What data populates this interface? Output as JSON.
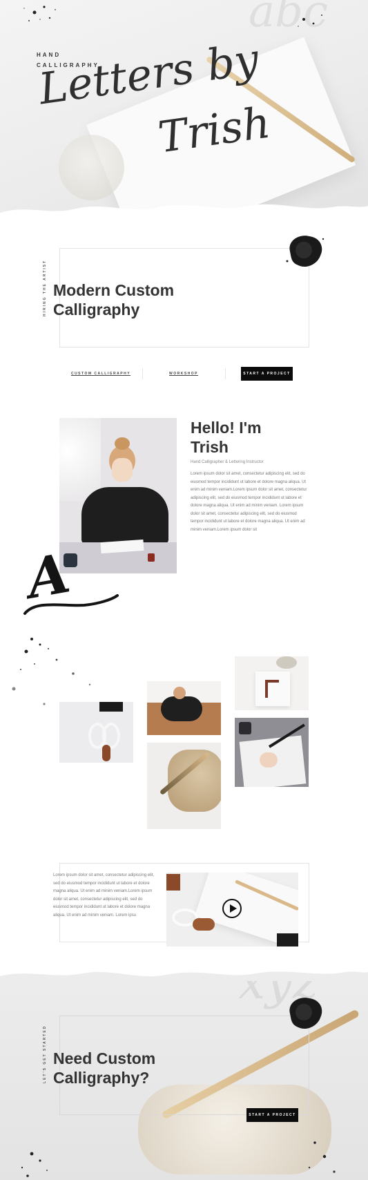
{
  "hero": {
    "eyebrow_line1": "HAND",
    "eyebrow_line2": "CALLIGRAPHY",
    "title_line1": "Letters by",
    "title_line2": "Trish",
    "bg_script": "abc"
  },
  "intro": {
    "vertical_label": "HIRING THE ARTIST",
    "heading_line1": "Modern Custom",
    "heading_line2": "Calligraphy"
  },
  "nav": {
    "link1": "CUSTOM CALLIGRAPHY",
    "link2": "WORKSHOP",
    "cta": "START A PROJECT"
  },
  "about": {
    "heading_line1": "Hello! I'm",
    "heading_line2": "Trish",
    "subtitle": "Hand Calligrapher & Lettering Instructor",
    "paragraph": "Lorem ipsum dolor sit amet, consectetur adipiscing elit, sed do eiusmod tempor incididunt ut labore et dolore magna aliqua. Ut enim ad minim veniam.Lorem ipsum dolor sit amet, consectetur adipiscing elit, sed do eiusmod tempor incididunt ut labore et dolore magna aliqua. Ut enim ad minim veniam. Lorem ipsum dolor sit amet, consectetur adipiscing elit, sed do eiusmod tempor incididunt ut labore et dolore magna aliqua. Ut enim ad minim veniam.Lorem ipsum dolor sit",
    "letter_mark": "A"
  },
  "video": {
    "paragraph": "Lorem ipsum dolor sit amet, consectetur adipiscing elit, sed do eiusmod tempor incididunt ut labore et dolore magna aliqua. Ut enim ad minim veniam.Lorem ipsum dolor sit amet, consectetur adipiscing elit, sed do eiusmod tempor incididunt ut labore et dolore magna aliqua. Ut enim ad minim veniam. Lorem ipsu"
  },
  "cta_section": {
    "bg_script": "xyz",
    "vertical_label": "LET'S GET STARTED",
    "heading_line1": "Need Custom",
    "heading_line2": "Calligraphy?",
    "button": "START A PROJECT"
  },
  "colors": {
    "ink": "#0c0c0c",
    "text": "#333333",
    "muted": "#777777",
    "paper": "#f2f2f2",
    "wood": "#d9b98a"
  },
  "icons": {
    "play": "play-icon"
  }
}
